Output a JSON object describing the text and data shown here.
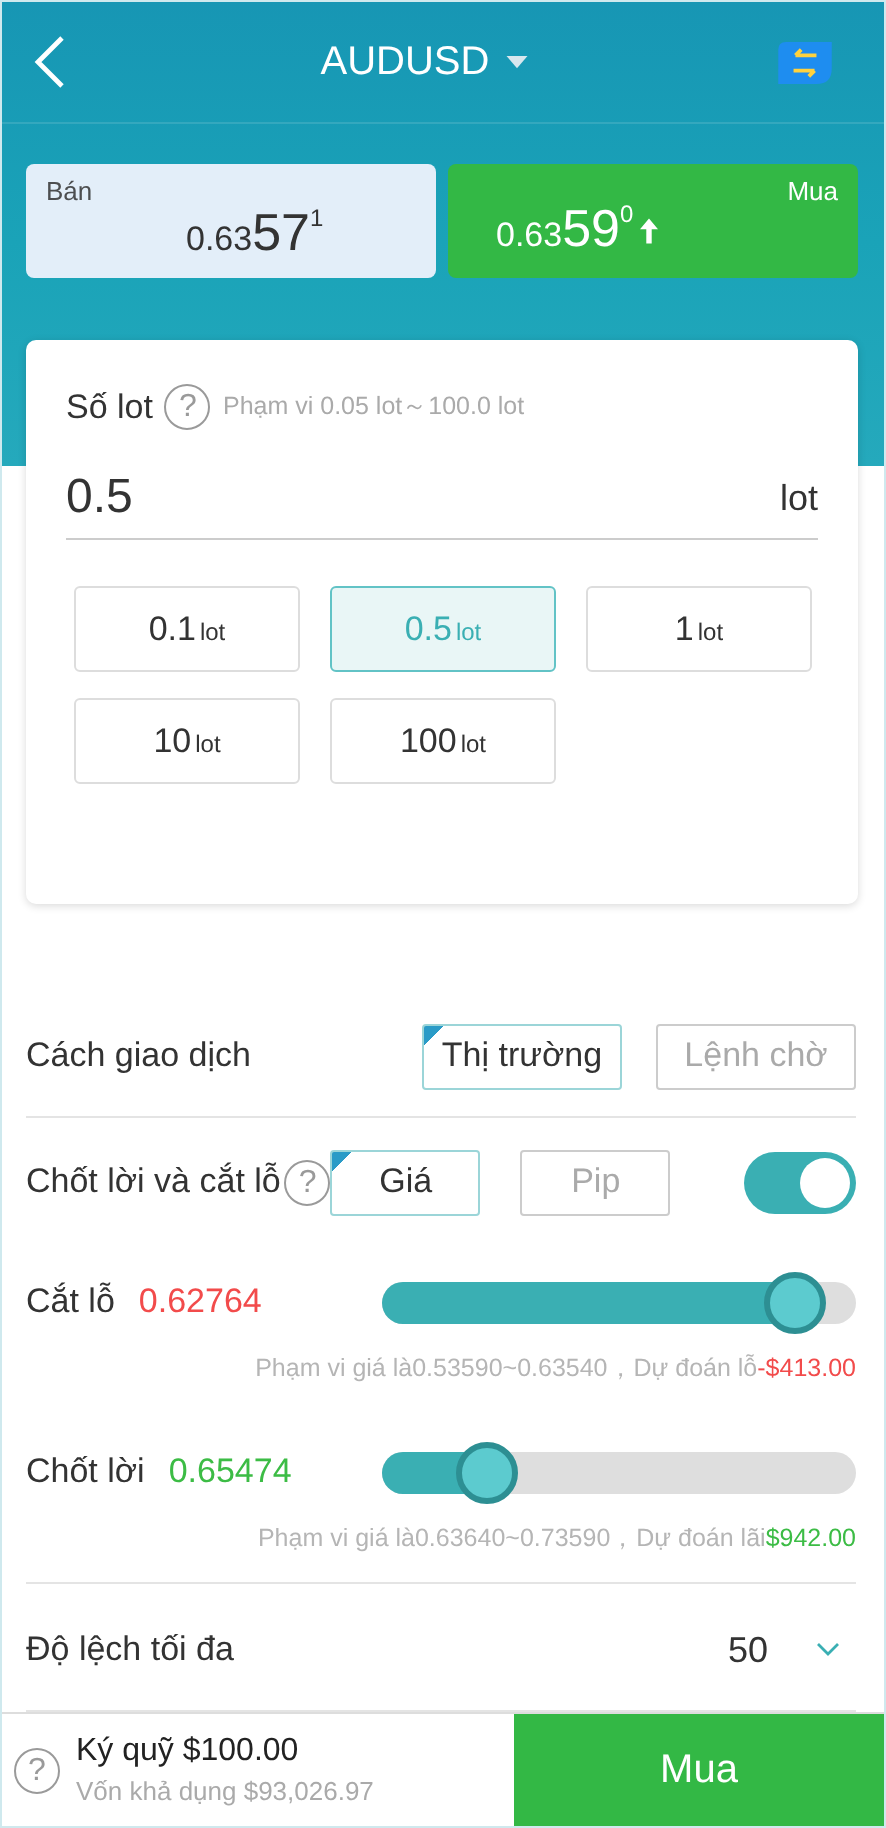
{
  "header": {
    "title": "AUDUSD"
  },
  "quotes": [
    {
      "kind": "sell",
      "label": "Bán",
      "prefix": "0.63",
      "big": "57",
      "pip": "1"
    },
    {
      "kind": "buy",
      "label": "Mua",
      "prefix": "0.63",
      "big": "59",
      "pip": "0"
    }
  ],
  "lot": {
    "label": "Số lot",
    "help": "?",
    "range": "Phạm vi  0.05 lot～100.0 lot",
    "value": "0.5",
    "unit": "lot",
    "presets": [
      {
        "amount": "0.1",
        "unit": "lot",
        "selected": false
      },
      {
        "amount": "0.5",
        "unit": "lot",
        "selected": true
      },
      {
        "amount": "1",
        "unit": "lot",
        "selected": false
      },
      {
        "amount": "10",
        "unit": "lot",
        "selected": false
      },
      {
        "amount": "100",
        "unit": "lot",
        "selected": false
      }
    ]
  },
  "trade_type": {
    "label": "Cách giao dịch",
    "options": [
      {
        "label": "Thị trường",
        "selected": true
      },
      {
        "label": "Lệnh chờ",
        "selected": false
      }
    ]
  },
  "tp_sl": {
    "label": "Chốt lời và cắt lỗ",
    "help": "?",
    "on": true,
    "options": [
      {
        "label": "Giá",
        "selected": true
      },
      {
        "label": "Pip",
        "selected": false
      }
    ]
  },
  "limits": [
    {
      "kind": "loss",
      "label": "Cắt lỗ",
      "value": "0.62764",
      "level": 0.87,
      "hint": "Phạm vi giá là0.53590~0.63540，Dự đoán lỗ",
      "estimate": "-$413.00"
    },
    {
      "kind": "profit",
      "label": "Chốt lời",
      "value": "0.65474",
      "level": 0.22,
      "hint": "Phạm vi giá là0.63640~0.73590，Dự đoán lãi",
      "estimate": "$942.00"
    }
  ],
  "slippage": {
    "label": "Độ lệch tối đa",
    "value": "50"
  },
  "footer": {
    "help": "?",
    "margin": "Ký quỹ $100.00",
    "available": "Vốn khả dụng $93,026.97",
    "action": "Mua"
  }
}
